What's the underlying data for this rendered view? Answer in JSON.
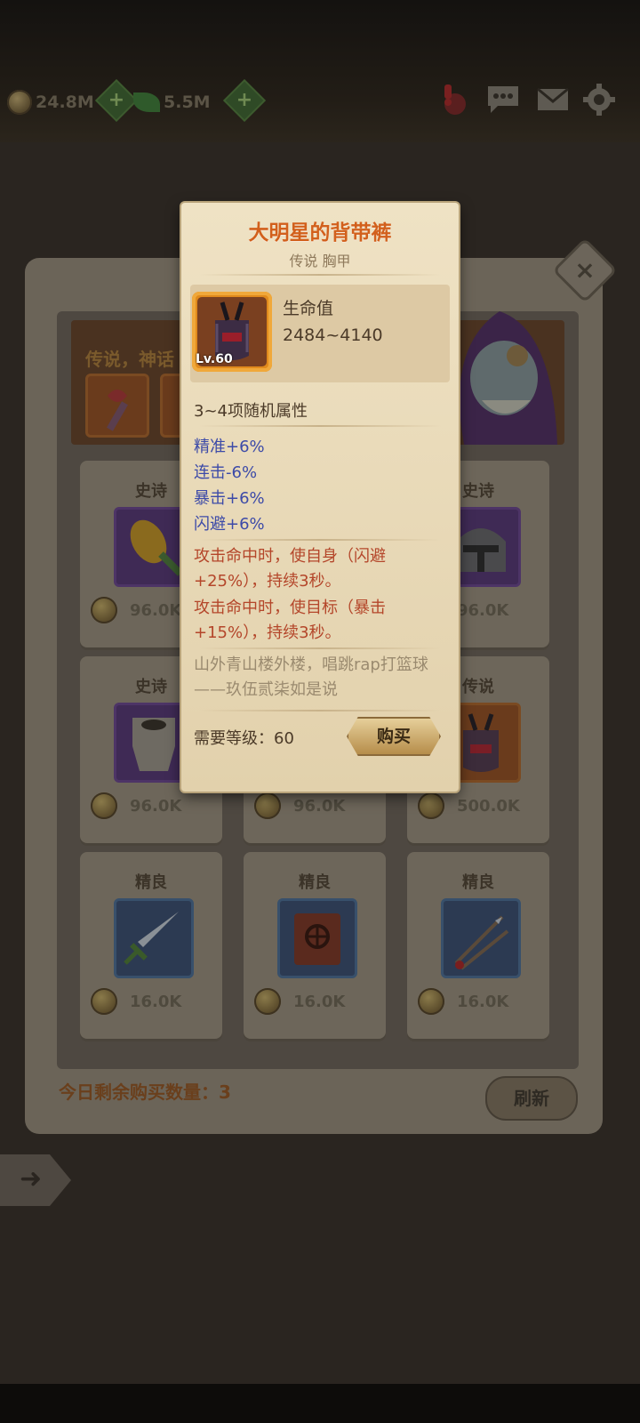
{
  "hud": {
    "coins": "24.8M",
    "gems": "5.5M"
  },
  "shop": {
    "banner_text": "传说，神话",
    "remaining_label": "今日剩余购买数量：3",
    "refresh_label": "刷新",
    "close_symbol": "×",
    "cards": [
      {
        "rarity": "史诗",
        "price": "96.0K",
        "item_icon": "flame-staff-icon"
      },
      {
        "rarity": "",
        "price": "",
        "item_icon": ""
      },
      {
        "rarity": "史诗",
        "price": "96.0K",
        "item_icon": "iron-helmet-icon"
      },
      {
        "rarity": "史诗",
        "price": "96.0K",
        "item_icon": "tower-shield-icon"
      },
      {
        "rarity": "",
        "price": "96.0K",
        "item_icon": ""
      },
      {
        "rarity": "传说",
        "price": "500.0K",
        "item_icon": "chest-armor-icon"
      },
      {
        "rarity": "精良",
        "price": "16.0K",
        "item_icon": "sword-icon"
      },
      {
        "rarity": "精良",
        "price": "16.0K",
        "item_icon": "spellbook-icon"
      },
      {
        "rarity": "精良",
        "price": "16.0K",
        "item_icon": "spear-icon"
      }
    ]
  },
  "tooltip": {
    "title": "大明星的背带裤",
    "subtitle": "传说 胸甲",
    "item_level": "Lv.60",
    "stat_name": "生命值",
    "stat_value": "2484~4140",
    "random_attr_label": "3~4项随机属性",
    "attributes": [
      "精准+6%",
      "连击-6%",
      "暴击+6%",
      "闪避+6%"
    ],
    "effects": [
      "攻击命中时，使自身（闪避+25%），持续3秒。",
      "攻击命中时，使目标（暴击+15%），持续3秒。"
    ],
    "flavor_text": "山外青山楼外楼，唱跳rap打篮球——玖伍贰柒如是说",
    "required_level": "需要等级：60",
    "buy_label": "购买"
  },
  "colors": {
    "title": "#d2601c",
    "attribute": "#3c4aa8",
    "effect": "#b4462a",
    "flavor": "#9a8a6f"
  }
}
